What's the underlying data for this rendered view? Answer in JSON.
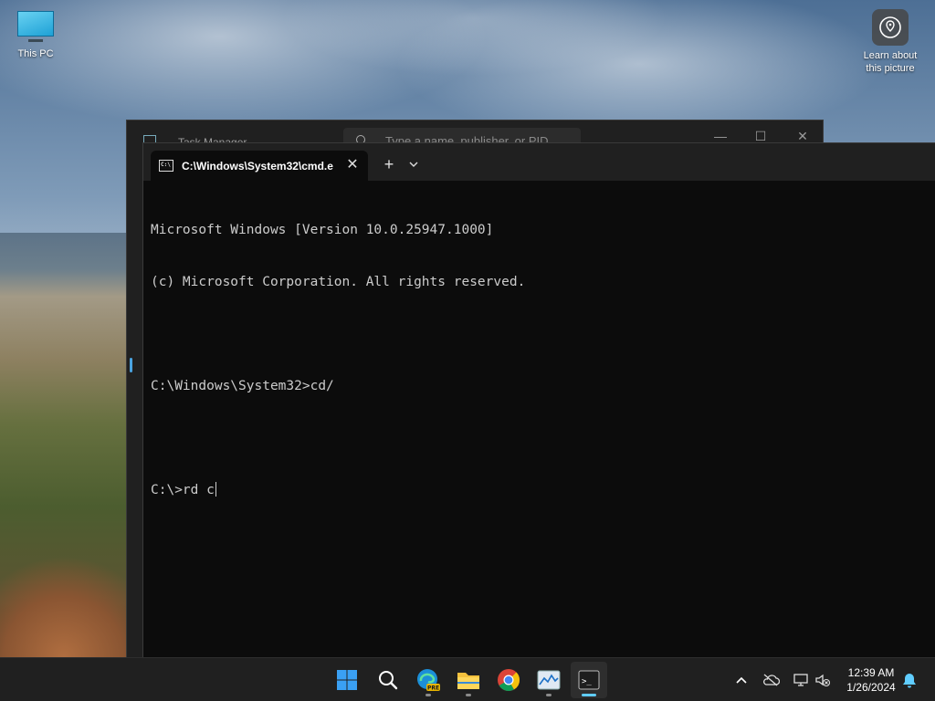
{
  "desktop": {
    "icons": [
      {
        "label": "This PC"
      },
      {
        "label": "Learn about this picture"
      }
    ]
  },
  "task_manager": {
    "title": "Task Manager",
    "search_placeholder": "Type a name, publisher, or PID",
    "controls": {
      "minimize": "—",
      "maximize": "☐",
      "close": "✕"
    }
  },
  "terminal": {
    "tab": {
      "title": "C:\\Windows\\System32\\cmd.e",
      "icon_text": "C:\\",
      "close": "✕"
    },
    "new_tab_label": "+",
    "console_lines": [
      "Microsoft Windows [Version 10.0.25947.1000]",
      "(c) Microsoft Corporation. All rights reserved.",
      "",
      "C:\\Windows\\System32>cd/",
      "",
      "C:\\>rd c"
    ]
  },
  "taskbar": {
    "apps": [
      "start-icon",
      "search-icon",
      "edge-pre-icon",
      "file-explorer-icon",
      "chrome-icon",
      "photos-icon",
      "terminal-icon"
    ],
    "edge_badge": "PRE",
    "terminal_icon_text": ">_",
    "tray": [
      "chevron-up-icon",
      "onedrive-icon",
      "network-icon",
      "volume-muted-icon",
      "notifications-icon"
    ],
    "time": "12:39 AM",
    "date": "1/26/2024"
  },
  "colors": {
    "terminal_bg": "#0c0c0c",
    "terminal_text": "#cccccc",
    "accent": "#60cdff",
    "taskbar_bg": "#202020"
  }
}
